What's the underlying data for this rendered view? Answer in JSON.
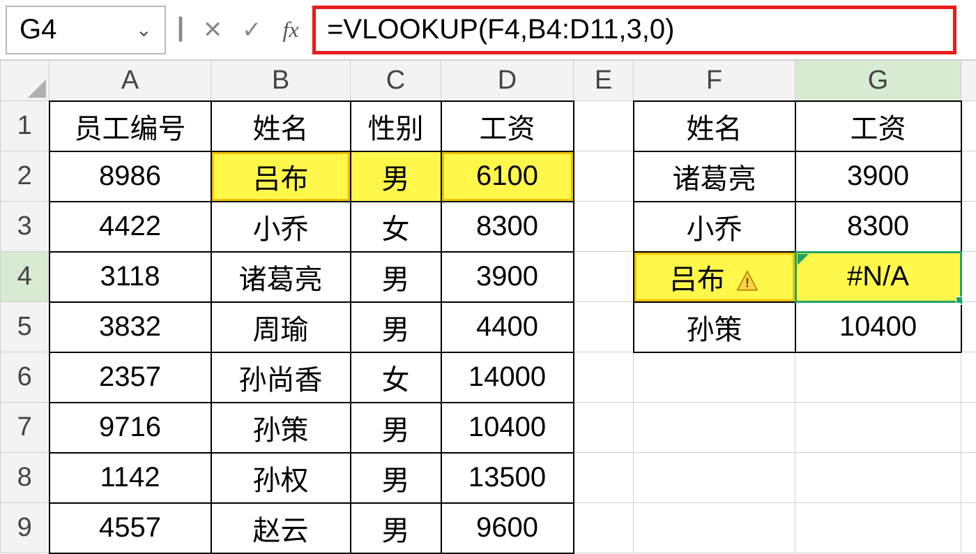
{
  "formula_bar": {
    "cell_ref": "G4",
    "formula": "=VLOOKUP(F4,B4:D11,3,0)"
  },
  "columns": [
    "A",
    "B",
    "C",
    "D",
    "E",
    "F",
    "G"
  ],
  "row_numbers": [
    "1",
    "2",
    "3",
    "4",
    "5",
    "6",
    "7",
    "8",
    "9"
  ],
  "active": {
    "col": "G",
    "row": "4"
  },
  "main_table": {
    "headers": {
      "A": "员工编号",
      "B": "姓名",
      "C": "性别",
      "D": "工资"
    },
    "rows": [
      {
        "A": "8986",
        "B": "吕布",
        "C": "男",
        "D": "6100"
      },
      {
        "A": "4422",
        "B": "小乔",
        "C": "女",
        "D": "8300"
      },
      {
        "A": "3118",
        "B": "诸葛亮",
        "C": "男",
        "D": "3900"
      },
      {
        "A": "3832",
        "B": "周瑜",
        "C": "男",
        "D": "4400"
      },
      {
        "A": "2357",
        "B": "孙尚香",
        "C": "女",
        "D": "14000"
      },
      {
        "A": "9716",
        "B": "孙策",
        "C": "男",
        "D": "10400"
      },
      {
        "A": "1142",
        "B": "孙权",
        "C": "男",
        "D": "13500"
      },
      {
        "A": "4557",
        "B": "赵云",
        "C": "男",
        "D": "9600"
      }
    ]
  },
  "lookup_table": {
    "headers": {
      "F": "姓名",
      "G": "工资"
    },
    "rows": [
      {
        "F": "诸葛亮",
        "G": "3900"
      },
      {
        "F": "小乔",
        "G": "8300"
      },
      {
        "F": "吕布",
        "G": "#N/A",
        "error": true,
        "f_truncated": "吕布"
      },
      {
        "F": "孙策",
        "G": "10400"
      }
    ]
  },
  "icons": {
    "dropdown_glyph": "⌄",
    "cancel_glyph": "✕",
    "enter_glyph": "✓",
    "fx_glyph": "fx"
  }
}
